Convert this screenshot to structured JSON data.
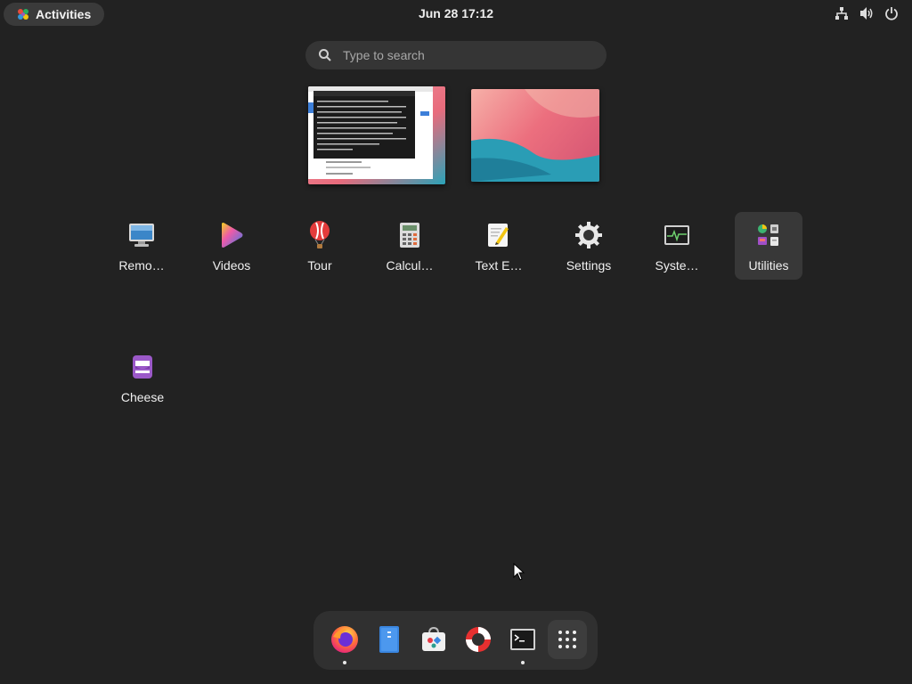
{
  "topbar": {
    "activities_label": "Activities",
    "clock": "Jun 28  17:12",
    "status_icons": [
      "network-icon",
      "volume-icon",
      "power-icon"
    ]
  },
  "search": {
    "placeholder": "Type to search"
  },
  "apps": [
    {
      "label": "Remo…",
      "icon": "remote-desktop-icon"
    },
    {
      "label": "Videos",
      "icon": "videos-icon"
    },
    {
      "label": "Tour",
      "icon": "tour-balloon-icon"
    },
    {
      "label": "Calcul…",
      "icon": "calculator-icon"
    },
    {
      "label": "Text E…",
      "icon": "text-editor-icon"
    },
    {
      "label": "Settings",
      "icon": "settings-gear-icon"
    },
    {
      "label": "Syste…",
      "icon": "system-monitor-icon"
    },
    {
      "label": "Utilities",
      "icon": "utilities-folder-icon",
      "selected": true
    },
    {
      "label": "Cheese",
      "icon": "cheese-icon"
    }
  ],
  "dash": [
    {
      "name": "firefox",
      "icon": "firefox-icon",
      "running": true
    },
    {
      "name": "files",
      "icon": "files-icon",
      "running": false
    },
    {
      "name": "software",
      "icon": "software-icon",
      "running": false
    },
    {
      "name": "help",
      "icon": "help-lifebuoy-icon",
      "running": false
    },
    {
      "name": "terminal",
      "icon": "terminal-icon",
      "running": true
    },
    {
      "name": "show-apps",
      "icon": "app-grid-icon",
      "running": false
    }
  ],
  "colors": {
    "background": "#222222",
    "topbar_pill": "#3a3a3a",
    "search_bg": "#353535",
    "dash_bg": "#303030",
    "selected_tile": "#383838"
  }
}
